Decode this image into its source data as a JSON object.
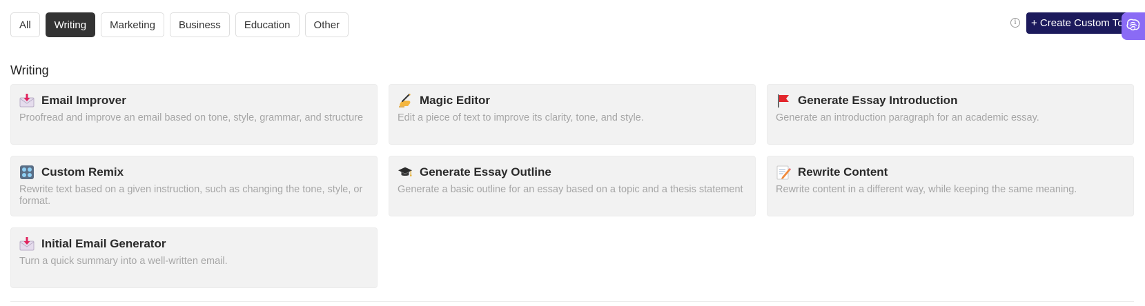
{
  "filters": [
    {
      "label": "All",
      "active": false
    },
    {
      "label": "Writing",
      "active": true
    },
    {
      "label": "Marketing",
      "active": false
    },
    {
      "label": "Business",
      "active": false
    },
    {
      "label": "Education",
      "active": false
    },
    {
      "label": "Other",
      "active": false
    }
  ],
  "header": {
    "info_icon": "info-icon",
    "create_button_label": "+ Create Custom To",
    "assistant_icon": "brain-icon"
  },
  "section": {
    "title": "Writing"
  },
  "cards": [
    {
      "icon": "incoming-envelope-icon",
      "title": "Email Improver",
      "description": "Proofread and improve an email based on tone, style, grammar, and structure"
    },
    {
      "icon": "writing-hand-icon",
      "title": "Magic Editor",
      "description": "Edit a piece of text to improve its clarity, tone, and style."
    },
    {
      "icon": "red-flag-icon",
      "title": "Generate Essay Introduction",
      "description": "Generate an introduction paragraph for an academic essay."
    },
    {
      "icon": "control-knobs-icon",
      "title": "Custom Remix",
      "description": "Rewrite text based on a given instruction, such as changing the tone, style, or format."
    },
    {
      "icon": "graduation-cap-icon",
      "title": "Generate Essay Outline",
      "description": "Generate a basic outline for an essay based on a topic and a thesis statement"
    },
    {
      "icon": "memo-icon",
      "title": "Rewrite Content",
      "description": "Rewrite content in a different way, while keeping the same meaning."
    },
    {
      "icon": "incoming-envelope-icon",
      "title": "Initial Email Generator",
      "description": "Turn a quick summary into a well-written email."
    }
  ],
  "colors": {
    "active_filter": "#333333",
    "create_button": "#1c1a5c",
    "assistant_fab": "#8a6bf5",
    "card_background": "#f2f2f2"
  }
}
